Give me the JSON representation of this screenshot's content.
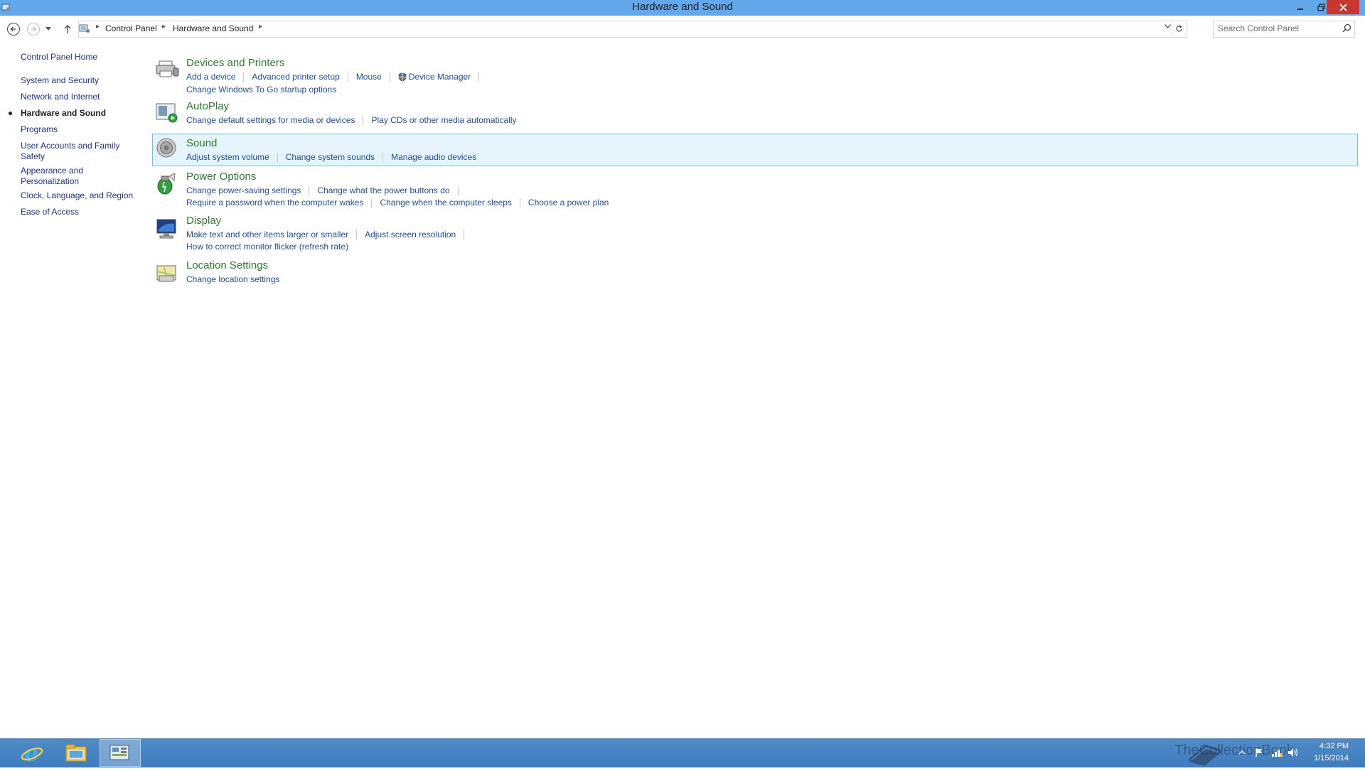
{
  "window": {
    "title": "Hardware and Sound"
  },
  "address_bar": {
    "breadcrumbs": [
      "Control Panel",
      "Hardware and Sound"
    ],
    "search_placeholder": "Search Control Panel"
  },
  "left_nav": {
    "items": [
      {
        "label": "Control Panel Home",
        "active": false
      },
      {
        "label": "System and Security",
        "active": false
      },
      {
        "label": "Network and Internet",
        "active": false
      },
      {
        "label": "Hardware and Sound",
        "active": true
      },
      {
        "label": "Programs",
        "active": false
      },
      {
        "label": "User Accounts and Family Safety",
        "active": false
      },
      {
        "label": "Appearance and Personalization",
        "active": false
      },
      {
        "label": "Clock, Language, and Region",
        "active": false
      },
      {
        "label": "Ease of Access",
        "active": false
      }
    ]
  },
  "categories": [
    {
      "title": "Devices and Printers",
      "icon": "printer-icon",
      "rows": [
        [
          "Add a device",
          "Advanced printer setup",
          "Mouse",
          "Device Manager"
        ],
        [
          "Change Windows To Go startup options"
        ]
      ]
    },
    {
      "title": "AutoPlay",
      "icon": "autoplay-icon",
      "rows": [
        [
          "Change default settings for media or devices",
          "Play CDs or other media automatically"
        ]
      ]
    },
    {
      "title": "Sound",
      "icon": "speaker-icon",
      "selected": true,
      "rows": [
        [
          "Adjust system volume",
          "Change system sounds",
          "Manage audio devices"
        ]
      ]
    },
    {
      "title": "Power Options",
      "icon": "battery-icon",
      "rows": [
        [
          "Change power-saving settings",
          "Change what the power buttons do"
        ],
        [
          "Require a password when the computer wakes",
          "Change when the computer sleeps",
          "Choose a power plan"
        ]
      ]
    },
    {
      "title": "Display",
      "icon": "monitor-icon",
      "rows": [
        [
          "Make text and other items larger or smaller",
          "Adjust screen resolution"
        ],
        [
          "How to correct monitor flicker (refresh rate)"
        ]
      ]
    },
    {
      "title": "Location Settings",
      "icon": "location-icon",
      "rows": [
        [
          "Change location settings"
        ]
      ]
    }
  ],
  "taskbar": {
    "apps": [
      {
        "name": "internet-explorer-icon"
      },
      {
        "name": "file-explorer-icon"
      },
      {
        "name": "control-panel-icon",
        "active": true
      }
    ],
    "clock": {
      "time": "4:32 PM",
      "date": "1/15/2014"
    },
    "watermark": "TheCollectionBook"
  },
  "colors": {
    "titlebar": "#63a8ea",
    "category_title": "#2a7d2a",
    "link": "#1e4d9e",
    "selected_bg": "#e5f3fb",
    "taskbar": "#4f8ac7"
  }
}
